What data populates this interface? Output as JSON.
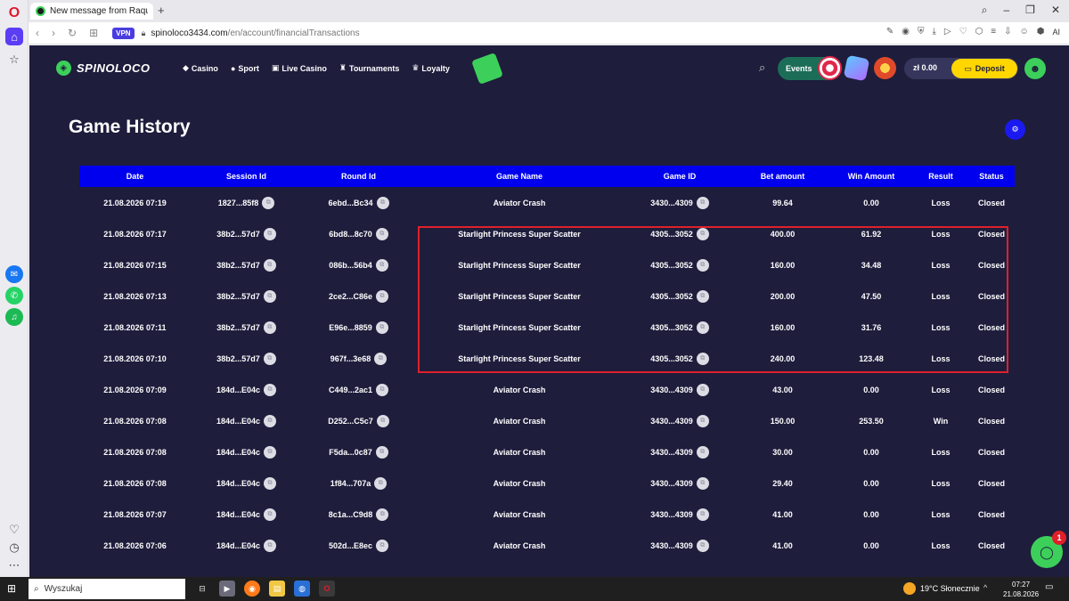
{
  "browser": {
    "tab_title": "New message from Raqu",
    "new_tab": "+",
    "url_host": "spinoloco3434.com",
    "url_path": "/en/account/financialTransactions",
    "vpn_label": "VPN",
    "ai_label": "AI"
  },
  "site": {
    "logo": "SPINOLOCO",
    "nav": [
      {
        "label": "Casino",
        "icon": "diamond-icon"
      },
      {
        "label": "Sport",
        "icon": "ball-icon"
      },
      {
        "label": "Live Casino",
        "icon": "cards-icon"
      },
      {
        "label": "Tournaments",
        "icon": "trophy-icon"
      },
      {
        "label": "Loyalty",
        "icon": "crown-icon"
      }
    ],
    "events_label": "Events",
    "balance": "zł 0.00",
    "deposit_label": "Deposit"
  },
  "page": {
    "title": "Game History"
  },
  "table": {
    "headers": [
      "Date",
      "Session Id",
      "Round Id",
      "Game Name",
      "Game ID",
      "Bet amount",
      "Win Amount",
      "Result",
      "Status"
    ],
    "rows": [
      [
        "21.08.2026 07:19",
        "1827...85f8",
        "6ebd...Bc34",
        "Aviator Crash",
        "3430...4309",
        "99.64",
        "0.00",
        "Loss",
        "Closed"
      ],
      [
        "21.08.2026 07:17",
        "38b2...57d7",
        "6bd8...8c70",
        "Starlight Princess Super Scatter",
        "4305...3052",
        "400.00",
        "61.92",
        "Loss",
        "Closed"
      ],
      [
        "21.08.2026 07:15",
        "38b2...57d7",
        "086b...56b4",
        "Starlight Princess Super Scatter",
        "4305...3052",
        "160.00",
        "34.48",
        "Loss",
        "Closed"
      ],
      [
        "21.08.2026 07:13",
        "38b2...57d7",
        "2ce2...C86e",
        "Starlight Princess Super Scatter",
        "4305...3052",
        "200.00",
        "47.50",
        "Loss",
        "Closed"
      ],
      [
        "21.08.2026 07:11",
        "38b2...57d7",
        "E96e...8859",
        "Starlight Princess Super Scatter",
        "4305...3052",
        "160.00",
        "31.76",
        "Loss",
        "Closed"
      ],
      [
        "21.08.2026 07:10",
        "38b2...57d7",
        "967f...3e68",
        "Starlight Princess Super Scatter",
        "4305...3052",
        "240.00",
        "123.48",
        "Loss",
        "Closed"
      ],
      [
        "21.08.2026 07:09",
        "184d...E04c",
        "C449...2ac1",
        "Aviator Crash",
        "3430...4309",
        "43.00",
        "0.00",
        "Loss",
        "Closed"
      ],
      [
        "21.08.2026 07:08",
        "184d...E04c",
        "D252...C5c7",
        "Aviator Crash",
        "3430...4309",
        "150.00",
        "253.50",
        "Win",
        "Closed"
      ],
      [
        "21.08.2026 07:08",
        "184d...E04c",
        "F5da...0c87",
        "Aviator Crash",
        "3430...4309",
        "30.00",
        "0.00",
        "Loss",
        "Closed"
      ],
      [
        "21.08.2026 07:08",
        "184d...E04c",
        "1f84...707a",
        "Aviator Crash",
        "3430...4309",
        "29.40",
        "0.00",
        "Loss",
        "Closed"
      ],
      [
        "21.08.2026 07:07",
        "184d...E04c",
        "8c1a...C9d8",
        "Aviator Crash",
        "3430...4309",
        "41.00",
        "0.00",
        "Loss",
        "Closed"
      ],
      [
        "21.08.2026 07:06",
        "184d...E04c",
        "502d...E8ec",
        "Aviator Crash",
        "3430...4309",
        "41.00",
        "0.00",
        "Loss",
        "Closed"
      ]
    ]
  },
  "chat": {
    "badge": "1"
  },
  "taskbar": {
    "search_label": "Wyszukaj",
    "weather": "19°C  Słonecznie",
    "time": "07:27",
    "date": "21.08.2026"
  },
  "colors": {
    "page_bg": "#1e1d3c",
    "table_header": "#0000ee",
    "accent_green": "#3cd05a",
    "deposit_yellow": "#ffd600",
    "highlight_red": "#e0202a"
  }
}
